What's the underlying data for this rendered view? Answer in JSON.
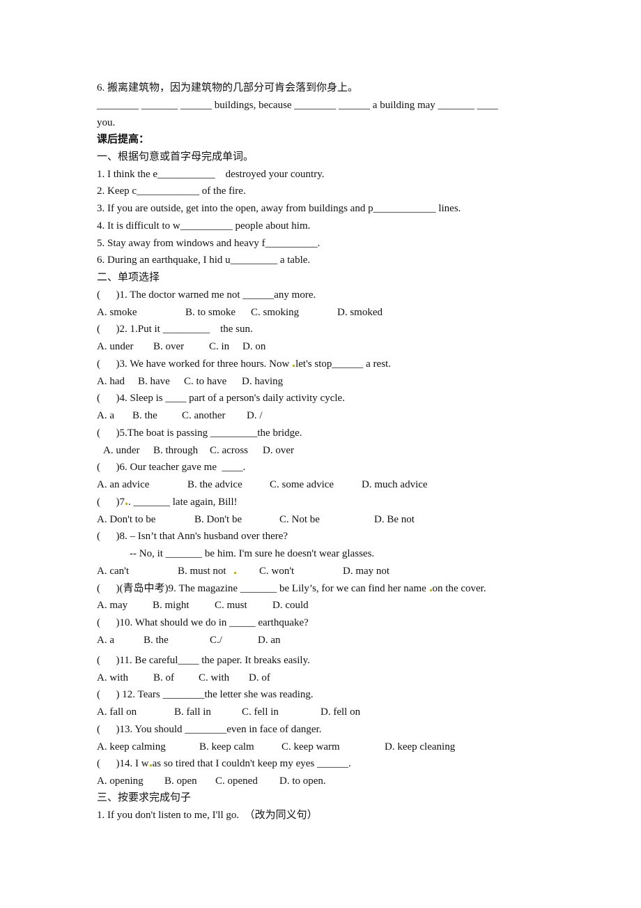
{
  "section_prev": {
    "item6_prompt": "6. 搬离建筑物，因为建筑物的几部分可肯会落到你身上。",
    "item6_line1": "________ _______ ______ buildings, because ________ ______ a building may _______ ____",
    "item6_line2": "you."
  },
  "after_class": {
    "heading": "课后提高：",
    "part1": {
      "title": "一、根据句意或首字母完成单词。",
      "items": [
        "1. I think the e___________    destroyed your country.",
        "2. Keep c____________ of the fire.",
        "3. If you are outside, get into the open, away from buildings and p____________ lines.",
        "4. It is difficult to w__________ people about him.",
        "5. Stay away from windows and heavy f__________.",
        "6. During an earthquake, I hid u_________ a table."
      ]
    },
    "part2": {
      "title": "二、单项选择",
      "questions": [
        {
          "stem": "(      )1. The doctor warned me not ______any more.",
          "options": [
            "A. smoke",
            "B. to smoke",
            "C. smoking",
            "D. smoked"
          ]
        },
        {
          "stem": "(      )2. 1.Put it _________    the sun.",
          "options": [
            "A. under",
            "B. over",
            "C. in",
            "D. on"
          ]
        },
        {
          "stem_a": "(      )3. We have worked for three hours. Now ",
          "stem_b": "let's stop______ a rest.",
          "options": [
            "A. had",
            "B. have",
            "C. to have",
            "D. having"
          ]
        },
        {
          "stem": "(      )4. Sleep is ____ part of a person's daily activity cycle.",
          "options": [
            "A. a",
            "B. the",
            "C. another",
            "D. /"
          ]
        },
        {
          "stem": "(      )5.The boat is passing _________the bridge.",
          "options": [
            "A. under",
            "B. through",
            "C. across",
            "D. over"
          ]
        },
        {
          "stem": "(      )6. Our teacher gave me  ____.",
          "options": [
            "A. an advice",
            "B. the advice",
            "C. some advice",
            "D. much advice"
          ]
        },
        {
          "stem_a": "(      )7",
          "stem_b": ". _______ late again, Bill!",
          "options": [
            "A. Don't to be",
            "B. Don't be",
            "C. Not be",
            "D. Be not"
          ]
        },
        {
          "stem": "(      )8. – Isn’t that Ann's husband over there?",
          "stem2": "-- No, it _______ be him. I'm sure he doesn't wear glasses.",
          "options": [
            "A. can't",
            "B. must not",
            "C. won't",
            "D. may not"
          ]
        },
        {
          "stem_a": "(      )(青岛中考)9. The magazine _______ be Lily’s, for we can find her name ",
          "stem_b": "on the cover.",
          "options": [
            "A. may",
            "B. might",
            "C. must",
            "D. could"
          ]
        },
        {
          "stem": "(      )10. What should we do in _____ earthquake?",
          "options": [
            "A. a",
            "B. the",
            "C./",
            "D. an"
          ]
        },
        {
          "stem": "(      )11. Be careful____ the paper. It breaks easily.",
          "options": [
            "A. with",
            "B. of",
            "C. with",
            "D. of"
          ]
        },
        {
          "stem": "(      ) 12. Tears ________the letter she was reading.",
          "options": [
            "A. fall on",
            "B. fall in",
            "C. fell in",
            "D. fell on"
          ]
        },
        {
          "stem": "(      )13. You should ________even in face of danger.",
          "options": [
            "A. keep calming",
            "B. keep calm",
            "C. keep warm",
            "D. keep cleaning"
          ]
        },
        {
          "stem_a": "(      )14. I w",
          "stem_b": "as so tired that I couldn't keep my eyes ______.",
          "options": [
            "A. opening",
            "B. open",
            "C. opened",
            "D. to open."
          ]
        }
      ]
    },
    "part3": {
      "title": "三、按要求完成句子",
      "items": [
        "1. If you don't listen to me, I'll go.  （改为同义句）"
      ]
    }
  },
  "colors": {
    "text": "#111111",
    "annotation_mark": "#c8b400",
    "background": "#ffffff"
  }
}
